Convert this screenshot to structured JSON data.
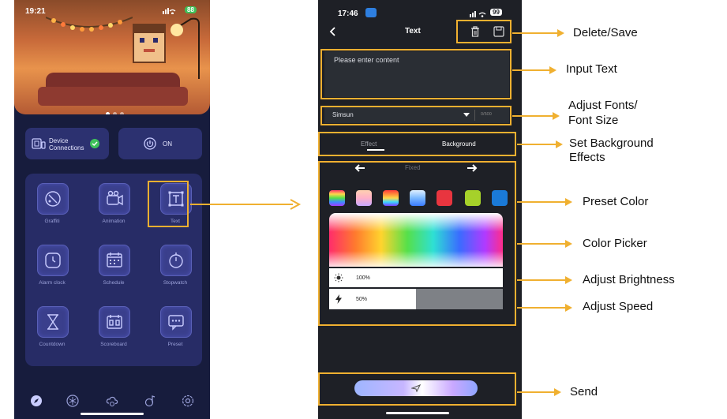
{
  "left_phone": {
    "status_time": "19:21",
    "status_icons": "signal-wifi-battery",
    "battery": "88",
    "device_connections_label": "Device\nConnections",
    "power_label": "ON",
    "grid_items": [
      {
        "label": "Graffiti",
        "icon": "palette-icon"
      },
      {
        "label": "Animation",
        "icon": "video-camera-icon"
      },
      {
        "label": "Text",
        "icon": "text-icon"
      },
      {
        "label": "Alarm clock",
        "icon": "alarm-clock-icon"
      },
      {
        "label": "Schedule",
        "icon": "calendar-icon"
      },
      {
        "label": "Stopwatch",
        "icon": "stopwatch-icon"
      },
      {
        "label": "Countdown",
        "icon": "hourglass-icon"
      },
      {
        "label": "Scoreboard",
        "icon": "scoreboard-icon"
      },
      {
        "label": "Preset",
        "icon": "chat-bubble-icon"
      }
    ],
    "nav_icons": [
      "compass-icon",
      "snowflake-icon",
      "cloud-icon",
      "music-icon",
      "settings-icon"
    ]
  },
  "right_phone": {
    "status_time": "17:46",
    "battery": "99",
    "title": "Text",
    "input_placeholder": "Please enter content",
    "font_value": "Simsun",
    "char_count": "0/500",
    "tabs": [
      "Effect",
      "Background"
    ],
    "mode_label": "Fixed",
    "preset_colors": [
      "rainbow-1",
      "peach-gradient",
      "rainbow-2",
      "sky-gradient",
      "#e8353f",
      "#a6d12a",
      "#1a7ad8"
    ],
    "brightness_text": "100%",
    "brightness_value": 1.0,
    "speed_text": "50%",
    "speed_value": 0.5
  },
  "callouts": {
    "delete_save": "Delete/Save",
    "input_text": "Input Text",
    "adjust_fonts_line1": "Adjust Fonts/",
    "adjust_fonts_line2": "Font Size",
    "set_background_line1": "Set Background",
    "set_background_line2": "Effects",
    "preset_color": "Preset Color",
    "color_picker": "Color Picker",
    "adjust_brightness": "Adjust Brightness",
    "adjust_speed": "Adjust Speed",
    "send": "Send"
  },
  "colors": {
    "accent": "#f0b030",
    "left_bg": "#171c3d",
    "right_bg": "#1e2026"
  }
}
